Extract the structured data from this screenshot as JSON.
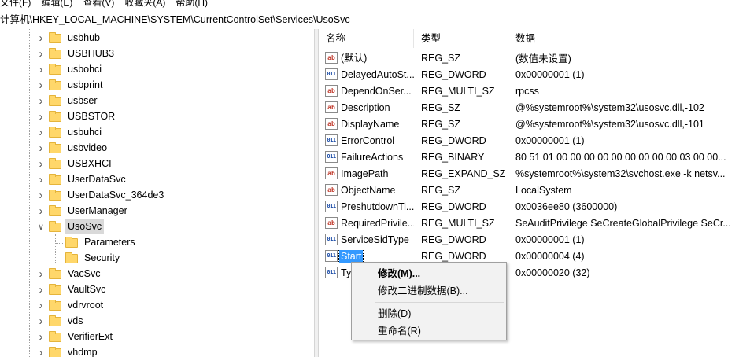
{
  "menubar": [
    "文件(F)",
    "编辑(E)",
    "查看(V)",
    "收藏夹(A)",
    "帮助(H)"
  ],
  "address": "计算机\\HKEY_LOCAL_MACHINE\\SYSTEM\\CurrentControlSet\\Services\\UsoSvc",
  "tree": {
    "items": [
      {
        "label": "usbhub",
        "expandable": true
      },
      {
        "label": "USBHUB3",
        "expandable": true
      },
      {
        "label": "usbohci",
        "expandable": true
      },
      {
        "label": "usbprint",
        "expandable": true
      },
      {
        "label": "usbser",
        "expandable": true
      },
      {
        "label": "USBSTOR",
        "expandable": true
      },
      {
        "label": "usbuhci",
        "expandable": true
      },
      {
        "label": "usbvideo",
        "expandable": true
      },
      {
        "label": "USBXHCI",
        "expandable": true
      },
      {
        "label": "UserDataSvc",
        "expandable": true
      },
      {
        "label": "UserDataSvc_364de3",
        "expandable": true
      },
      {
        "label": "UserManager",
        "expandable": true
      },
      {
        "label": "UsoSvc",
        "expandable": true,
        "expanded": true,
        "selected": true
      },
      {
        "label": "Parameters",
        "child": true
      },
      {
        "label": "Security",
        "child": true
      },
      {
        "label": "VacSvc",
        "expandable": true
      },
      {
        "label": "VaultSvc",
        "expandable": true
      },
      {
        "label": "vdrvroot",
        "expandable": true
      },
      {
        "label": "vds",
        "expandable": true
      },
      {
        "label": "VerifierExt",
        "expandable": true
      },
      {
        "label": "vhdmp",
        "expandable": true
      }
    ]
  },
  "list": {
    "headers": {
      "name": "名称",
      "type": "类型",
      "data": "数据"
    },
    "rows": [
      {
        "name": "(默认)",
        "type": "REG_SZ",
        "data": "(数值未设置)",
        "icon": "string-value-icon"
      },
      {
        "name": "DelayedAutoSt...",
        "type": "REG_DWORD",
        "data": "0x00000001 (1)",
        "icon": "binary-value-icon"
      },
      {
        "name": "DependOnSer...",
        "type": "REG_MULTI_SZ",
        "data": "rpcss",
        "icon": "string-value-icon"
      },
      {
        "name": "Description",
        "type": "REG_SZ",
        "data": "@%systemroot%\\system32\\usosvc.dll,-102",
        "icon": "string-value-icon"
      },
      {
        "name": "DisplayName",
        "type": "REG_SZ",
        "data": "@%systemroot%\\system32\\usosvc.dll,-101",
        "icon": "string-value-icon"
      },
      {
        "name": "ErrorControl",
        "type": "REG_DWORD",
        "data": "0x00000001 (1)",
        "icon": "binary-value-icon"
      },
      {
        "name": "FailureActions",
        "type": "REG_BINARY",
        "data": "80 51 01 00 00 00 00 00 00 00 00 00 03 00 00...",
        "icon": "binary-value-icon"
      },
      {
        "name": "ImagePath",
        "type": "REG_EXPAND_SZ",
        "data": "%systemroot%\\system32\\svchost.exe -k netsv...",
        "icon": "string-value-icon"
      },
      {
        "name": "ObjectName",
        "type": "REG_SZ",
        "data": "LocalSystem",
        "icon": "string-value-icon"
      },
      {
        "name": "PreshutdownTi...",
        "type": "REG_DWORD",
        "data": "0x0036ee80 (3600000)",
        "icon": "binary-value-icon"
      },
      {
        "name": "RequiredPrivile...",
        "type": "REG_MULTI_SZ",
        "data": "SeAuditPrivilege SeCreateGlobalPrivilege SeCr...",
        "icon": "string-value-icon"
      },
      {
        "name": "ServiceSidType",
        "type": "REG_DWORD",
        "data": "0x00000001 (1)",
        "icon": "binary-value-icon"
      },
      {
        "name": "Start",
        "type": "REG_DWORD",
        "data": "0x00000004 (4)",
        "icon": "binary-value-icon",
        "selected": true
      },
      {
        "name": "Ty",
        "type": "",
        "data": "0x00000020 (32)",
        "icon": "binary-value-icon"
      }
    ]
  },
  "context_menu": {
    "modify": "修改(M)...",
    "modify_binary": "修改二进制数据(B)...",
    "delete": "删除(D)",
    "rename": "重命名(R)"
  }
}
